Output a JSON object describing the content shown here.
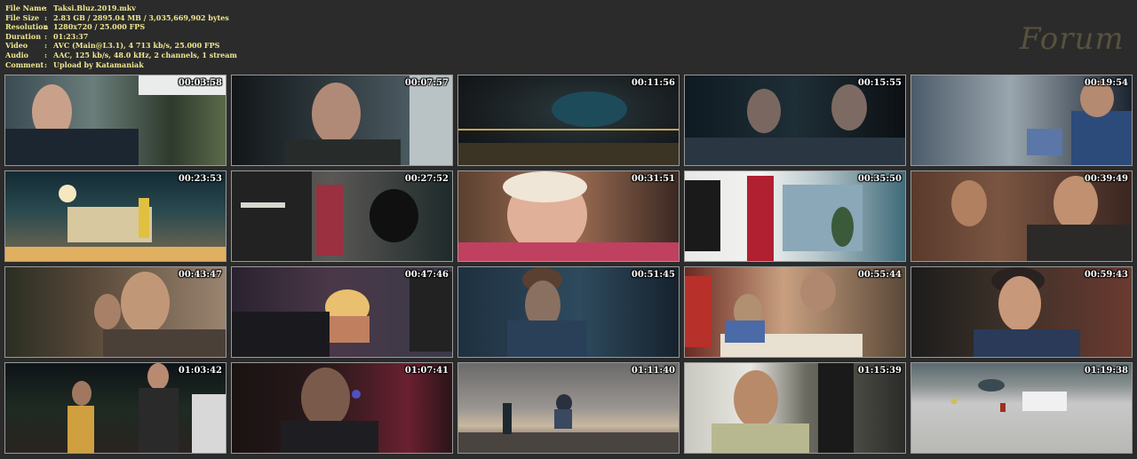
{
  "info": [
    {
      "key": "File Name",
      "value": "Taksi.Bluz.2019.mkv"
    },
    {
      "key": "File Size",
      "value": "2.83 GB  / 2895.04 MB  / 3,035,669,902  bytes"
    },
    {
      "key": "Resolution",
      "value": "1280x720 / 25.000 FPS"
    },
    {
      "key": "Duration",
      "value": "01:23:37"
    },
    {
      "key": "Video",
      "value": "AVC (Main@L3.1), 4 713 kb/s, 25.000 FPS"
    },
    {
      "key": "Audio",
      "value": "AAC, 125 kb/s, 48.0 kHz, 2 channels, 1 stream"
    },
    {
      "key": "Comment",
      "value": "Upload by Katamaniak"
    }
  ],
  "watermark": "Forum",
  "thumbnails": [
    {
      "time": "00:03:58",
      "scene": "man-driving-car"
    },
    {
      "time": "00:07:57",
      "scene": "man-in-car-closeup"
    },
    {
      "time": "00:11:56",
      "scene": "aerial-roundabout-night"
    },
    {
      "time": "00:15:55",
      "scene": "dark-car-interior"
    },
    {
      "time": "00:19:54",
      "scene": "boy-with-flyers"
    },
    {
      "time": "00:23:53",
      "scene": "street-night-taxi"
    },
    {
      "time": "00:27:52",
      "scene": "kitchen-cable"
    },
    {
      "time": "00:31:51",
      "scene": "woman-singing-car"
    },
    {
      "time": "00:35:50",
      "scene": "car-door-shop"
    },
    {
      "time": "00:39:49",
      "scene": "driver-and-boy"
    },
    {
      "time": "00:43:47",
      "scene": "driver-boy-car"
    },
    {
      "time": "00:47:46",
      "scene": "woman-phone-room"
    },
    {
      "time": "00:51:45",
      "scene": "boy-on-phone-blue"
    },
    {
      "time": "00:55:44",
      "scene": "diner-table"
    },
    {
      "time": "00:59:43",
      "scene": "woman-shocked-car"
    },
    {
      "time": "01:03:42",
      "scene": "couple-night-street"
    },
    {
      "time": "01:07:41",
      "scene": "man-red-light"
    },
    {
      "time": "01:11:40",
      "scene": "boy-on-rocks-sunset"
    },
    {
      "time": "01:15:39",
      "scene": "man-driving-smile"
    },
    {
      "time": "01:19:38",
      "scene": "aerial-car-lot"
    }
  ]
}
